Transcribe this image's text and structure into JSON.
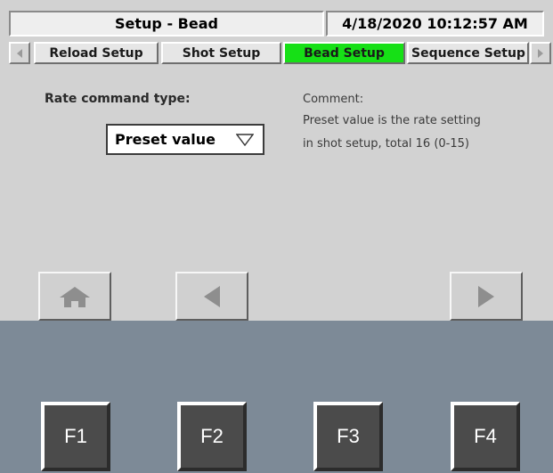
{
  "header": {
    "title": "Setup - Bead",
    "datetime": "4/18/2020 10:12:57 AM"
  },
  "tabs": [
    {
      "label": "Reload Setup",
      "active": false
    },
    {
      "label": "Shot Setup",
      "active": false
    },
    {
      "label": "Bead Setup",
      "active": true
    },
    {
      "label": "Sequence Setup",
      "active": false
    }
  ],
  "tab_nav": {
    "left_icon": "chevron-left-icon",
    "right_icon": "chevron-right-icon"
  },
  "rate_command": {
    "label": "Rate command type:",
    "selected": "Preset value"
  },
  "comment": {
    "title": "Comment:",
    "line1": "Preset value is the rate setting",
    "line2": "in shot setup, total 16 (0-15)"
  },
  "nav_buttons": {
    "home_icon": "home-icon",
    "back_icon": "arrow-left-icon",
    "forward_icon": "arrow-right-icon"
  },
  "function_keys": [
    "F1",
    "F2",
    "F3",
    "F4"
  ],
  "colors": {
    "active_tab": "#16e016",
    "panel_bg": "#d2d2d2",
    "fkey_panel": "#7d8a97",
    "fkey_bg": "#4b4b4b"
  }
}
